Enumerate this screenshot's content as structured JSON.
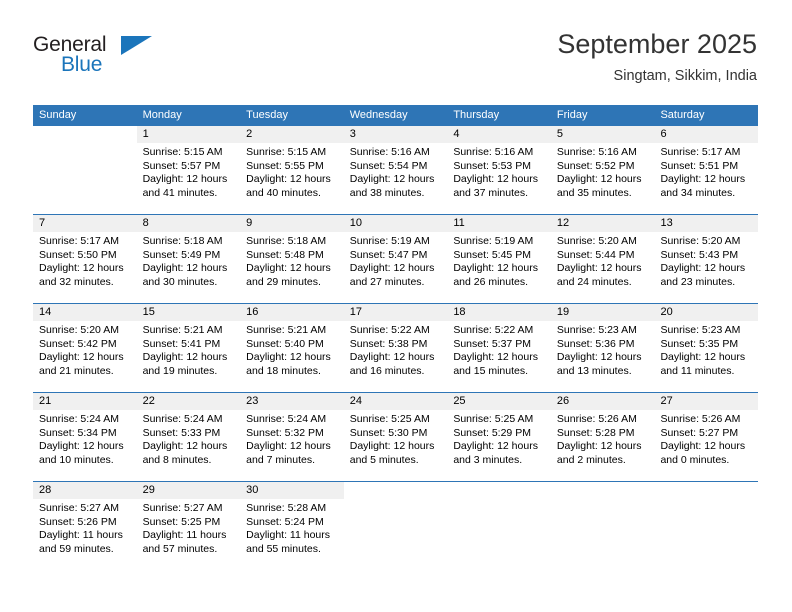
{
  "brand": {
    "name_top": "General",
    "name_bottom": "Blue"
  },
  "header": {
    "title": "September 2025",
    "subtitle": "Singtam, Sikkim, India"
  },
  "colors": {
    "header_blue": "#2E75B6",
    "logo_blue": "#1B75BB",
    "day_band_gray": "#F0F0F0",
    "text": "#000000"
  },
  "weekdays": [
    "Sunday",
    "Monday",
    "Tuesday",
    "Wednesday",
    "Thursday",
    "Friday",
    "Saturday"
  ],
  "weeks": [
    [
      {
        "day": "",
        "sunrise": "",
        "sunset": "",
        "daylight_1": "",
        "daylight_2": ""
      },
      {
        "day": "1",
        "sunrise": "Sunrise: 5:15 AM",
        "sunset": "Sunset: 5:57 PM",
        "daylight_1": "Daylight: 12 hours",
        "daylight_2": "and 41 minutes."
      },
      {
        "day": "2",
        "sunrise": "Sunrise: 5:15 AM",
        "sunset": "Sunset: 5:55 PM",
        "daylight_1": "Daylight: 12 hours",
        "daylight_2": "and 40 minutes."
      },
      {
        "day": "3",
        "sunrise": "Sunrise: 5:16 AM",
        "sunset": "Sunset: 5:54 PM",
        "daylight_1": "Daylight: 12 hours",
        "daylight_2": "and 38 minutes."
      },
      {
        "day": "4",
        "sunrise": "Sunrise: 5:16 AM",
        "sunset": "Sunset: 5:53 PM",
        "daylight_1": "Daylight: 12 hours",
        "daylight_2": "and 37 minutes."
      },
      {
        "day": "5",
        "sunrise": "Sunrise: 5:16 AM",
        "sunset": "Sunset: 5:52 PM",
        "daylight_1": "Daylight: 12 hours",
        "daylight_2": "and 35 minutes."
      },
      {
        "day": "6",
        "sunrise": "Sunrise: 5:17 AM",
        "sunset": "Sunset: 5:51 PM",
        "daylight_1": "Daylight: 12 hours",
        "daylight_2": "and 34 minutes."
      }
    ],
    [
      {
        "day": "7",
        "sunrise": "Sunrise: 5:17 AM",
        "sunset": "Sunset: 5:50 PM",
        "daylight_1": "Daylight: 12 hours",
        "daylight_2": "and 32 minutes."
      },
      {
        "day": "8",
        "sunrise": "Sunrise: 5:18 AM",
        "sunset": "Sunset: 5:49 PM",
        "daylight_1": "Daylight: 12 hours",
        "daylight_2": "and 30 minutes."
      },
      {
        "day": "9",
        "sunrise": "Sunrise: 5:18 AM",
        "sunset": "Sunset: 5:48 PM",
        "daylight_1": "Daylight: 12 hours",
        "daylight_2": "and 29 minutes."
      },
      {
        "day": "10",
        "sunrise": "Sunrise: 5:19 AM",
        "sunset": "Sunset: 5:47 PM",
        "daylight_1": "Daylight: 12 hours",
        "daylight_2": "and 27 minutes."
      },
      {
        "day": "11",
        "sunrise": "Sunrise: 5:19 AM",
        "sunset": "Sunset: 5:45 PM",
        "daylight_1": "Daylight: 12 hours",
        "daylight_2": "and 26 minutes."
      },
      {
        "day": "12",
        "sunrise": "Sunrise: 5:20 AM",
        "sunset": "Sunset: 5:44 PM",
        "daylight_1": "Daylight: 12 hours",
        "daylight_2": "and 24 minutes."
      },
      {
        "day": "13",
        "sunrise": "Sunrise: 5:20 AM",
        "sunset": "Sunset: 5:43 PM",
        "daylight_1": "Daylight: 12 hours",
        "daylight_2": "and 23 minutes."
      }
    ],
    [
      {
        "day": "14",
        "sunrise": "Sunrise: 5:20 AM",
        "sunset": "Sunset: 5:42 PM",
        "daylight_1": "Daylight: 12 hours",
        "daylight_2": "and 21 minutes."
      },
      {
        "day": "15",
        "sunrise": "Sunrise: 5:21 AM",
        "sunset": "Sunset: 5:41 PM",
        "daylight_1": "Daylight: 12 hours",
        "daylight_2": "and 19 minutes."
      },
      {
        "day": "16",
        "sunrise": "Sunrise: 5:21 AM",
        "sunset": "Sunset: 5:40 PM",
        "daylight_1": "Daylight: 12 hours",
        "daylight_2": "and 18 minutes."
      },
      {
        "day": "17",
        "sunrise": "Sunrise: 5:22 AM",
        "sunset": "Sunset: 5:38 PM",
        "daylight_1": "Daylight: 12 hours",
        "daylight_2": "and 16 minutes."
      },
      {
        "day": "18",
        "sunrise": "Sunrise: 5:22 AM",
        "sunset": "Sunset: 5:37 PM",
        "daylight_1": "Daylight: 12 hours",
        "daylight_2": "and 15 minutes."
      },
      {
        "day": "19",
        "sunrise": "Sunrise: 5:23 AM",
        "sunset": "Sunset: 5:36 PM",
        "daylight_1": "Daylight: 12 hours",
        "daylight_2": "and 13 minutes."
      },
      {
        "day": "20",
        "sunrise": "Sunrise: 5:23 AM",
        "sunset": "Sunset: 5:35 PM",
        "daylight_1": "Daylight: 12 hours",
        "daylight_2": "and 11 minutes."
      }
    ],
    [
      {
        "day": "21",
        "sunrise": "Sunrise: 5:24 AM",
        "sunset": "Sunset: 5:34 PM",
        "daylight_1": "Daylight: 12 hours",
        "daylight_2": "and 10 minutes."
      },
      {
        "day": "22",
        "sunrise": "Sunrise: 5:24 AM",
        "sunset": "Sunset: 5:33 PM",
        "daylight_1": "Daylight: 12 hours",
        "daylight_2": "and 8 minutes."
      },
      {
        "day": "23",
        "sunrise": "Sunrise: 5:24 AM",
        "sunset": "Sunset: 5:32 PM",
        "daylight_1": "Daylight: 12 hours",
        "daylight_2": "and 7 minutes."
      },
      {
        "day": "24",
        "sunrise": "Sunrise: 5:25 AM",
        "sunset": "Sunset: 5:30 PM",
        "daylight_1": "Daylight: 12 hours",
        "daylight_2": "and 5 minutes."
      },
      {
        "day": "25",
        "sunrise": "Sunrise: 5:25 AM",
        "sunset": "Sunset: 5:29 PM",
        "daylight_1": "Daylight: 12 hours",
        "daylight_2": "and 3 minutes."
      },
      {
        "day": "26",
        "sunrise": "Sunrise: 5:26 AM",
        "sunset": "Sunset: 5:28 PM",
        "daylight_1": "Daylight: 12 hours",
        "daylight_2": "and 2 minutes."
      },
      {
        "day": "27",
        "sunrise": "Sunrise: 5:26 AM",
        "sunset": "Sunset: 5:27 PM",
        "daylight_1": "Daylight: 12 hours",
        "daylight_2": "and 0 minutes."
      }
    ],
    [
      {
        "day": "28",
        "sunrise": "Sunrise: 5:27 AM",
        "sunset": "Sunset: 5:26 PM",
        "daylight_1": "Daylight: 11 hours",
        "daylight_2": "and 59 minutes."
      },
      {
        "day": "29",
        "sunrise": "Sunrise: 5:27 AM",
        "sunset": "Sunset: 5:25 PM",
        "daylight_1": "Daylight: 11 hours",
        "daylight_2": "and 57 minutes."
      },
      {
        "day": "30",
        "sunrise": "Sunrise: 5:28 AM",
        "sunset": "Sunset: 5:24 PM",
        "daylight_1": "Daylight: 11 hours",
        "daylight_2": "and 55 minutes."
      },
      {
        "day": "",
        "sunrise": "",
        "sunset": "",
        "daylight_1": "",
        "daylight_2": ""
      },
      {
        "day": "",
        "sunrise": "",
        "sunset": "",
        "daylight_1": "",
        "daylight_2": ""
      },
      {
        "day": "",
        "sunrise": "",
        "sunset": "",
        "daylight_1": "",
        "daylight_2": ""
      },
      {
        "day": "",
        "sunrise": "",
        "sunset": "",
        "daylight_1": "",
        "daylight_2": ""
      }
    ]
  ]
}
